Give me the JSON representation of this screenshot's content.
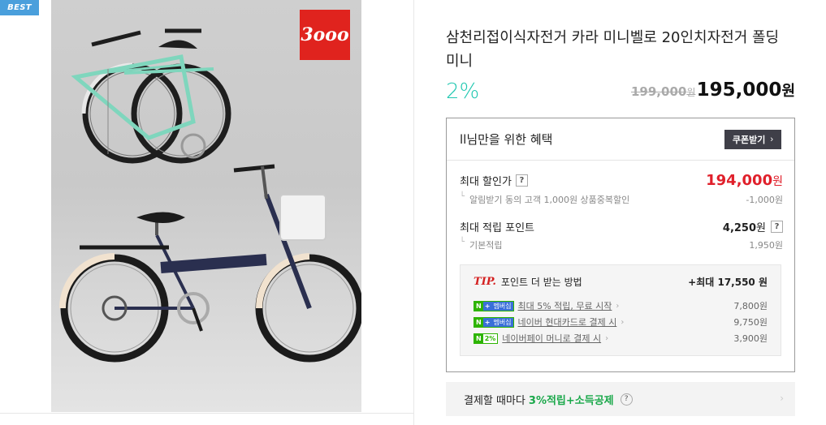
{
  "badge": {
    "label": "BEST"
  },
  "image": {
    "brand_logo_text": "3ooo"
  },
  "product": {
    "title": "삼천리접이식자전거 카라 미니벨로 20인치자전거 폴딩 미니",
    "discount": "2%",
    "original_price": "199,000",
    "original_unit": "원",
    "price": "195,000",
    "price_unit": "원"
  },
  "benefits": {
    "title": "ll님만을 위한 혜택",
    "coupon_button": "쿠폰받기",
    "max_discount": {
      "label": "최대 할인가",
      "value": "194,000",
      "unit": "원",
      "sub_label": "알림받기 동의 고객 1,000원 상품중복할인",
      "sub_value": "-1,000원"
    },
    "max_points": {
      "label": "최대 적립 포인트",
      "value": "4,250",
      "unit": "원",
      "sub_label": "기본적립",
      "sub_value": "1,950원"
    },
    "tip": {
      "tag": "TIP.",
      "title": "포인트 더 받는 방법",
      "max": "+최대 17,550 원",
      "items": [
        {
          "badge": "멤버십",
          "label": "최대 5% 적립, 무료 시작",
          "value": "7,800원"
        },
        {
          "badge": "멤버십",
          "label": "네이버 현대카드로 결제 시",
          "value": "9,750원"
        },
        {
          "badge": "2%",
          "label": "네이버페이 머니로 결제 시",
          "value": "3,900원"
        }
      ]
    }
  },
  "pay_bar": {
    "text": "결제할 때마다",
    "highlight": "3%적립+소득공제"
  },
  "colors": {
    "accent_teal": "#1fc7b0",
    "price_red": "#e0202b",
    "naver_green": "#2db400",
    "best_blue": "#4a9fdc"
  }
}
